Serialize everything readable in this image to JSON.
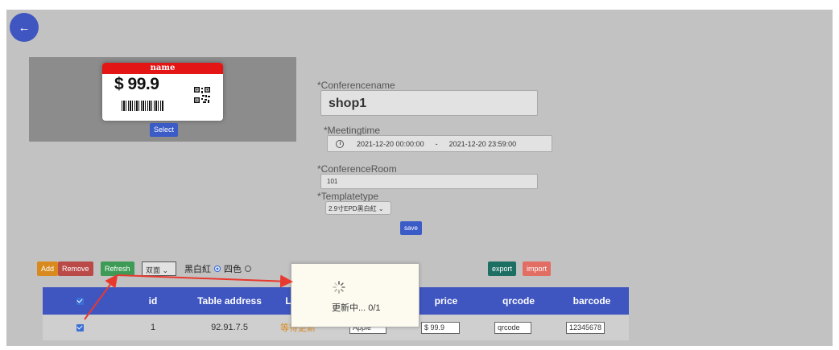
{
  "nav": {
    "back_icon": "←"
  },
  "preview": {
    "tag_header": "name",
    "tag_price": "$ 99.9",
    "select_label": "Select"
  },
  "form": {
    "conference_name_label": "*Conferencename",
    "conference_name_value": "shop1",
    "meeting_time_label": "*Meetingtime",
    "start_time": "2021-12-20 00:00:00",
    "range_separator": "-",
    "end_time": "2021-12-20 23:59:00",
    "conference_room_label": "*ConferenceRoom",
    "conference_room_value": "101",
    "template_type_label": "*Templatetype",
    "template_type_value": "2.9寸EPD黑白紅",
    "save_label": "save"
  },
  "toolbar": {
    "add_label": "Add",
    "remove_label": "Remove",
    "refresh_label": "Refresh",
    "mode_value": "双面",
    "radio_option_1": "黑白紅",
    "radio_option_2": "四色",
    "export_label": "export",
    "import_label": "import"
  },
  "table": {
    "headers": [
      "✓",
      "id",
      "Table address",
      "Lab",
      "price",
      "qrcode",
      "barcode"
    ],
    "rows": [
      {
        "id": "1",
        "address": "92.91.7.5",
        "status": "等待更新",
        "label": "Apple",
        "price": "$ 99.9",
        "qrcode": "qrcode",
        "barcode": "12345678"
      }
    ]
  },
  "modal": {
    "text": "更新中... 0/1"
  },
  "colors": {
    "accent": "#3f55c0",
    "annotation_arrow": "#e8392f",
    "status": "#d98a1f"
  }
}
